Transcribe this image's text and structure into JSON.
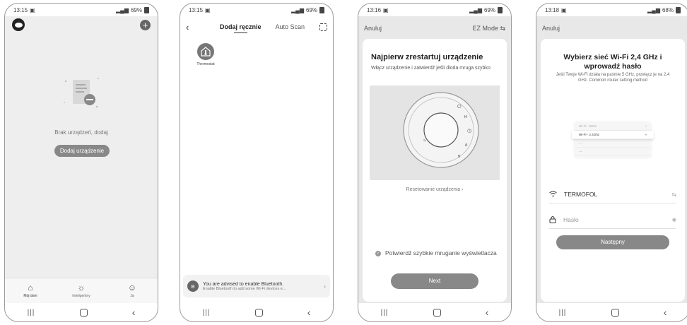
{
  "screen1": {
    "status": {
      "time": "13:15",
      "battery": "69%"
    },
    "empty_text": "Brak urządzeń, dodaj",
    "add_device_label": "Dodaj urządzenie",
    "tabs": [
      {
        "label": "Mój dom",
        "icon": "home-icon"
      },
      {
        "label": "Inteligentny",
        "icon": "sun-icon"
      },
      {
        "label": "Ja",
        "icon": "person-icon"
      }
    ]
  },
  "screen2": {
    "status": {
      "time": "13:15",
      "battery": "69%"
    },
    "tab_manual": "Dodaj ręcznie",
    "tab_auto": "Auto Scan",
    "device_label": "Thermostat",
    "bt_title": "You are advised to enable Bluetooth.",
    "bt_sub": "Enable Bluetooth to add some Wi-Fi devices e..."
  },
  "screen3": {
    "status": {
      "time": "13:16",
      "battery": "69%"
    },
    "cancel": "Anuluj",
    "mode": "EZ Mode ⇆",
    "title": "Najpierw zrestartuj urządzenie",
    "desc": "Włącz urządzenie i zatwierdź jeśli dioda mruga szybko",
    "reset_link": "Resetowanie urządzenia ›",
    "confirm_text": "Potwierdź szybkie mruganie wyświetlacza",
    "next_label": "Next"
  },
  "screen4": {
    "status": {
      "time": "13:18",
      "battery": "68%"
    },
    "cancel": "Anuluj",
    "title": "Wybierz sieć Wi-Fi 2,4 GHz i wprowadź hasło",
    "desc": "Jeśli Twoje Wi-Fi działa na paśmie 5 GHz, przełącz je na 2,4 GHz. Common router setting method",
    "wifi_rows": [
      "Wi-Fi - 5Ghz",
      "Wi-Fi - 2.4Ghz"
    ],
    "ssid": "TERMOFOL",
    "password_placeholder": "Hasło",
    "next_label": "Następny"
  }
}
